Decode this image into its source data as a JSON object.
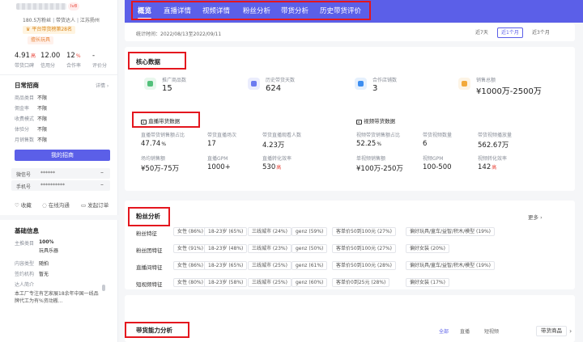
{
  "profile": {
    "fans": "180.5万粉丝",
    "role": "带货达人",
    "location": "江苏扬州",
    "rank_badge": "平台带货榜第28名",
    "tag": "擅长玩具",
    "avatar_badge": "lv8"
  },
  "scores": [
    {
      "value": "4.91",
      "suffix": "高",
      "label": "带货口碑"
    },
    {
      "value": "12.00",
      "suffix": "",
      "label": "信用分"
    },
    {
      "value": "12",
      "suffix": "%",
      "label": "合作率"
    },
    {
      "value": "-",
      "suffix": "",
      "label": "评价分"
    }
  ],
  "recruit": {
    "title": "日常招商",
    "detail_link": "详情",
    "rows": [
      {
        "label": "商品类目",
        "value": "不限"
      },
      {
        "label": "佣金率",
        "value": "不限"
      },
      {
        "label": "收费模式",
        "value": "不限"
      },
      {
        "label": "体验分",
        "value": "不限"
      },
      {
        "label": "月销售数",
        "value": "不限"
      }
    ],
    "button": "我的招商"
  },
  "contacts": [
    {
      "label": "微信号",
      "value": "******"
    },
    {
      "label": "手机号",
      "value": "**********"
    }
  ],
  "actions": {
    "collect": "收藏",
    "online_chat": "在线沟通",
    "send_order": "发起订单"
  },
  "basic_info": {
    "title": "基础信息",
    "rows": [
      {
        "label": "主推类目",
        "value": "100%",
        "value2": "玩具乐器"
      },
      {
        "label": "内容类型",
        "value": "随拍",
        "value2": ""
      },
      {
        "label": "签约机构",
        "value": "暂无",
        "value2": ""
      }
    ],
    "intro_label": "达人简介",
    "intro_text": "本工厂专注有艺家展18余年中国一线品牌代工为有%资动搬..."
  },
  "nav": {
    "tabs": [
      "概览",
      "直播详情",
      "视频详情",
      "粉丝分析",
      "带货分析",
      "历史带货评价"
    ],
    "active": 0
  },
  "period": {
    "label": "统计时间：2022/08/13至2022/09/11",
    "options": [
      "近7天",
      "近1个月",
      "近3个月"
    ],
    "active": 1
  },
  "core": {
    "title": "核心数据",
    "metrics": [
      {
        "label": "推广商品数",
        "value": "15",
        "icon": "goods-icon",
        "color": "#52c07a"
      },
      {
        "label": "历史带货天数",
        "value": "624",
        "icon": "calendar-icon",
        "color": "#6b7bf0"
      },
      {
        "label": "合作店铺数",
        "value": "3",
        "icon": "store-icon",
        "color": "#3d8ef0"
      },
      {
        "label": "销售总额",
        "value": "¥1000万-2500万",
        "icon": "coin-icon",
        "color": "#f2a93b"
      }
    ],
    "live_title": "直播带货数据",
    "video_title": "视频带货数据",
    "live_stats": [
      {
        "label": "直播带货销售额占比",
        "value": "47.74",
        "unit": "%"
      },
      {
        "label": "带货直播场次",
        "value": "17",
        "unit": ""
      },
      {
        "label": "带货直播观看人数",
        "value": "4.23万",
        "unit": ""
      },
      {
        "label": "场均销售额",
        "value": "¥50万-75万",
        "unit": ""
      },
      {
        "label": "直播GPM",
        "value": "1000+",
        "unit": ""
      },
      {
        "label": "直播转化效率",
        "value": "530",
        "unit": "高"
      }
    ],
    "video_stats": [
      {
        "label": "视频带货销售额占比",
        "value": "52.25",
        "unit": "%"
      },
      {
        "label": "带货视频数量",
        "value": "6",
        "unit": ""
      },
      {
        "label": "带货视频播放量",
        "value": "562.67万",
        "unit": ""
      },
      {
        "label": "单视频销售额",
        "value": "¥100万-250万",
        "unit": ""
      },
      {
        "label": "视频GPM",
        "value": "100-500",
        "unit": ""
      },
      {
        "label": "视频转化效率",
        "value": "142",
        "unit": "高"
      }
    ]
  },
  "fans": {
    "title": "粉丝分析",
    "more": "更多",
    "rows": [
      {
        "label": "粉丝特征",
        "tags": [
          "女性 (86%)",
          "18-23岁 (65%)",
          "三线城市 (24%)",
          "genz (59%)",
          "客单价50到100元 (27%)",
          "偏好玩具/童车/益智/积木/模型 (19%)"
        ]
      },
      {
        "label": "粉丝团特征",
        "tags": [
          "女性 (91%)",
          "18-23岁 (48%)",
          "三线城市 (23%)",
          "genz (50%)",
          "客单价50到100元 (27%)",
          "偏好女装 (20%)"
        ]
      },
      {
        "label": "直播间特征",
        "tags": [
          "女性 (86%)",
          "18-23岁 (65%)",
          "三线城市 (25%)",
          "genz (61%)",
          "客单价50到100元 (28%)",
          "偏好玩具/童车/益智/积木/模型 (19%)"
        ]
      },
      {
        "label": "短视频特征",
        "tags": [
          "女性 (80%)",
          "18-23岁 (58%)",
          "三线城市 (25%)",
          "genz (60%)",
          "客单价0到25元 (28%)",
          "偏好女装 (17%)"
        ]
      }
    ]
  },
  "sales": {
    "title": "带货能力分析",
    "filters": [
      "全部",
      "直播",
      "短视频"
    ],
    "active": 0,
    "link": "带货商品"
  }
}
